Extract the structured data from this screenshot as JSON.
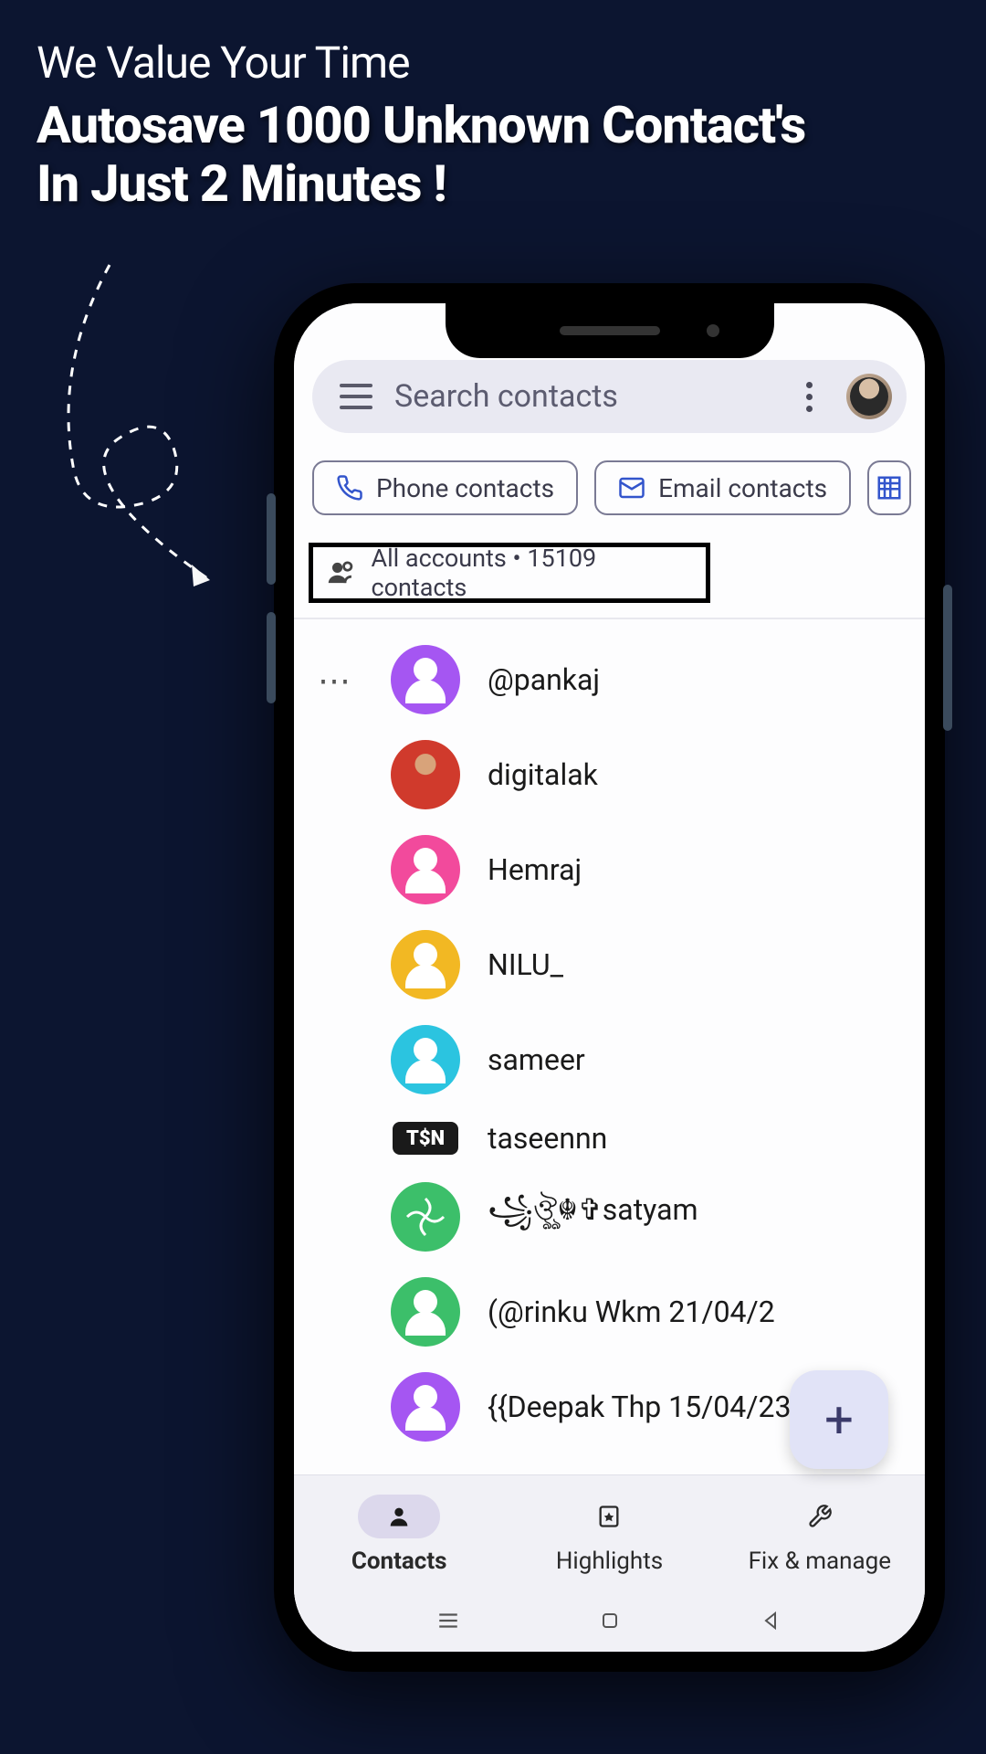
{
  "marketing": {
    "subtitle": "We Value Your Time",
    "headline_1": "Autosave 1000 Unknown Contact's",
    "headline_2": "In Just 2 Minutes !"
  },
  "search": {
    "placeholder": "Search contacts"
  },
  "chips": {
    "phone": "Phone contacts",
    "email": "Email contacts"
  },
  "accounts": {
    "label": "All accounts",
    "separator": "•",
    "count": "15109 contacts"
  },
  "contacts": [
    {
      "name": "@pankaj",
      "avatar_type": "silhouette",
      "color": "#a556f2"
    },
    {
      "name": "digitalak",
      "avatar_type": "photo",
      "color": "#d03a2c"
    },
    {
      "name": "Hemraj",
      "avatar_type": "silhouette",
      "color": "#f24a9c"
    },
    {
      "name": "NILU_",
      "avatar_type": "silhouette",
      "color": "#f2b823"
    },
    {
      "name": "sameer",
      "avatar_type": "silhouette",
      "color": "#2bc4e0"
    },
    {
      "name": "taseennn",
      "avatar_type": "logo",
      "color": "#1a1a1a",
      "logo_text": "T$N"
    },
    {
      "name": "꧁ঔৣ☬✞satyam",
      "avatar_type": "pattern",
      "color": "#3cbf6a"
    },
    {
      "name": "(@rinku Wkm 21/04/2",
      "avatar_type": "silhouette",
      "color": "#3cbf6a"
    },
    {
      "name": "{{Deepak Thp 15/04/23",
      "avatar_type": "silhouette",
      "color": "#a556f2"
    }
  ],
  "nav": {
    "contacts": "Contacts",
    "highlights": "Highlights",
    "fix": "Fix & manage"
  }
}
